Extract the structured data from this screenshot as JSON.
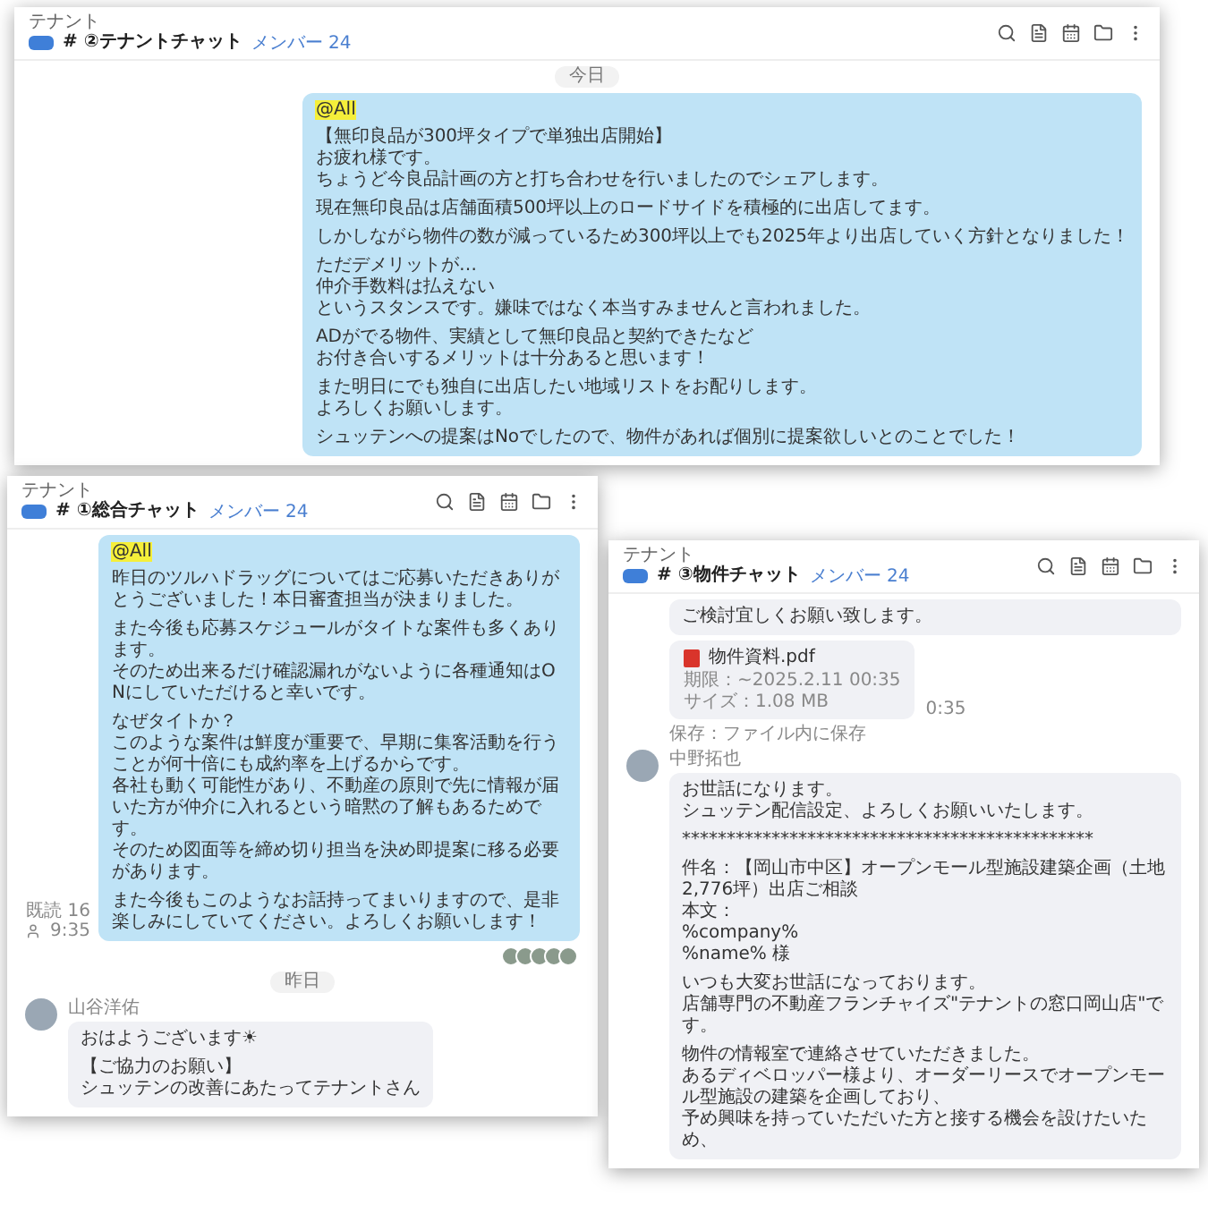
{
  "windows": [
    {
      "tag": "テナント",
      "title": "# ②テナントチャット",
      "members": "メンバー 24",
      "messages": [
        {
          "kind": "date",
          "text": "今日"
        },
        {
          "kind": "own",
          "mention": "@All",
          "paragraphs": [
            [
              "【無印良品が300坪タイプで単独出店開始】",
              "お疲れ様です。",
              "ちょうど今良品計画の方と打ち合わせを行いましたのでシェアします。"
            ],
            [
              "現在無印良品は店舗面積500坪以上のロードサイドを積極的に出店してます。"
            ],
            [
              "しかしながら物件の数が減っているため300坪以上でも2025年より出店していく方針となりました！"
            ],
            [
              "ただデメリットが…",
              "仲介手数料は払えない",
              "というスタンスです。嫌味ではなく本当すみませんと言われました。"
            ],
            [
              "ADがでる物件、実績として無印良品と契約できたなど",
              "お付き合いするメリットは十分あると思います！"
            ],
            [
              "また明日にでも独自に出店したい地域リストをお配りします。",
              "よろしくお願いします。"
            ],
            [
              "シュッテンへの提案はNoでしたので、物件があれば個別に提案欲しいとのことでした！"
            ]
          ]
        }
      ]
    },
    {
      "tag": "テナント",
      "title": "# ①総合チャット",
      "members": "メンバー 24",
      "messages": [
        {
          "kind": "own",
          "mention": "@All",
          "paragraphs": [
            [
              "昨日のツルハドラッグについてはご応募いただきありがとうございました！本日審査担当が決まりました。"
            ],
            [
              "また今後も応募スケジュールがタイトな案件も多くあります。",
              "そのため出来るだけ確認漏れがないように各種通知はONにしていただけると幸いです。"
            ],
            [
              "なぜタイトか？",
              "このような案件は鮮度が重要で、早期に集客活動を行うことが何十倍にも成約率を上げるからです。",
              "各社も動く可能性があり、不動産の原則で先に情報が届いた方が仲介に入れるという暗黙の了解もあるためです。",
              "そのため図面等を締め切り担当を決め即提案に移る必要があります。"
            ],
            [
              "また今後もこのようなお話持ってまいりますので、是非楽しみにしていてください。よろしくお願いします！"
            ]
          ],
          "read": "既読 16",
          "time": "9:35",
          "reactions": true
        },
        {
          "kind": "date",
          "text": "昨日"
        },
        {
          "kind": "other",
          "name": "山谷洋佑",
          "paragraphs": [
            [
              "おはようございます☀"
            ],
            [
              "【ご協力のお願い】",
              "シュッテンの改善にあたってテナントさん"
            ]
          ]
        }
      ]
    },
    {
      "tag": "テナント",
      "title": "# ③物件チャット",
      "members": "メンバー 24",
      "messages": [
        {
          "kind": "continued",
          "paragraphs": [
            [
              "ご検討宜しくお願い致します。"
            ]
          ]
        },
        {
          "kind": "file",
          "name": "物件資料.pdf",
          "expiry": "期限：~2025.2.11 00:35",
          "size": "サイズ：1.08 MB",
          "time": "0:35"
        },
        {
          "kind": "note",
          "text": "保存：ファイル内に保存"
        },
        {
          "kind": "other",
          "name": "中野拓也",
          "paragraphs": [
            [
              "お世話になります。",
              "シュッテン配信設定、よろしくお願いいたします。"
            ],
            [
              "**********************************************"
            ],
            [
              "件名：【岡山市中区】オープンモール型施設建築企画（土地2,776坪）出店ご相談",
              "本文：",
              "%company%",
              "%name% 様"
            ],
            [
              "いつも大変お世話になっております。",
              "店舗専門の不動産フランチャイズ\"テナントの窓口岡山店\"です。"
            ],
            [
              "物件の情報室で連絡させていただきました。",
              "あるディベロッパー様より、オーダーリースでオープンモール型施設の建築を企画しており、",
              "予め興味を持っていただいた方と接する機会を設けたいため、"
            ]
          ]
        }
      ]
    }
  ]
}
